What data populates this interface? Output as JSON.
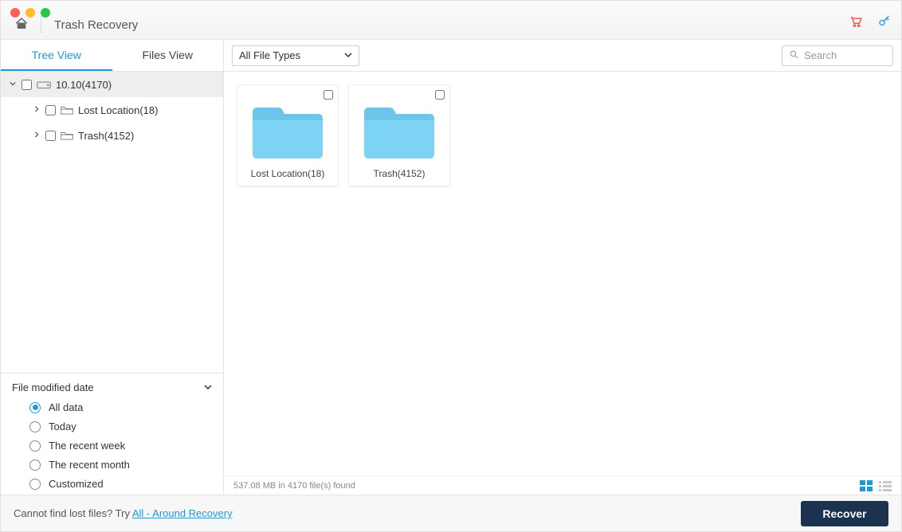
{
  "title": "Trash Recovery",
  "tabs": {
    "tree": "Tree View",
    "files": "Files View"
  },
  "filetype_select": "All File Types",
  "search": {
    "placeholder": "Search"
  },
  "tree": {
    "root": "10.10(4170)",
    "children": [
      {
        "label": "Lost Location(18)"
      },
      {
        "label": "Trash(4152)"
      }
    ]
  },
  "folders": [
    {
      "label": "Lost Location(18)"
    },
    {
      "label": "Trash(4152)"
    }
  ],
  "filter": {
    "header": "File modified date",
    "options": [
      "All data",
      "Today",
      "The recent week",
      "The recent month",
      "Customized"
    ],
    "selected": 0
  },
  "status": "537.08 MB in 4170 file(s) found",
  "footer": {
    "prefix": "Cannot find lost files? Try ",
    "link": "All - Around Recovery"
  },
  "recover": "Recover"
}
